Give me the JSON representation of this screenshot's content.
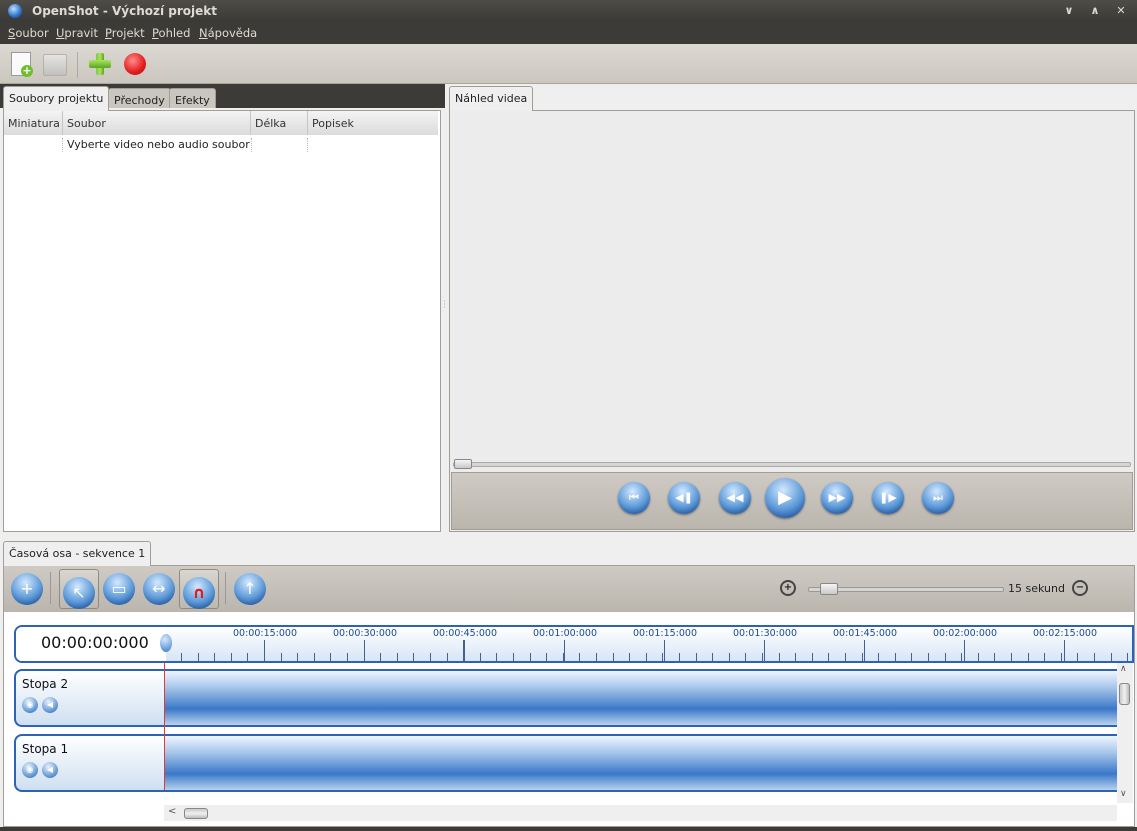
{
  "window": {
    "title": "OpenShot - Výchozí projekt"
  },
  "menu": [
    "Soubor",
    "Upravit",
    "Projekt",
    "Pohled",
    "Nápověda"
  ],
  "left_tabs": [
    "Soubory projektu",
    "Přechody",
    "Efekty"
  ],
  "file_table": {
    "columns": [
      "Miniatura",
      "Soubor",
      "Délka",
      "Popisek"
    ],
    "rows": [
      {
        "miniatura": "",
        "soubor": "Vyberte video nebo audio soubor",
        "delka": "",
        "popisek": ""
      }
    ]
  },
  "preview_tab": "Náhled videa",
  "timeline_tab": "Časová osa - sekvence 1",
  "timeline": {
    "zoom_label": "15 sekund",
    "timecode": "00:00:00:000",
    "ruler": [
      "00:00:15:000",
      "00:00:30:000",
      "00:00:45:000",
      "00:01:00:000",
      "00:01:15:000",
      "00:01:30:000",
      "00:01:45:000",
      "00:02:00:000",
      "00:02:15:000"
    ],
    "tracks": [
      {
        "name": "Stopa 2"
      },
      {
        "name": "Stopa 1"
      }
    ]
  },
  "icons": {
    "toolbar": [
      "new-project-icon",
      "save-project-icon",
      "import-files-icon",
      "record-icon"
    ],
    "transport": [
      "jump-start-icon",
      "prev-marker-icon",
      "rewind-icon",
      "play-icon",
      "fast-forward-icon",
      "next-marker-icon",
      "jump-end-icon"
    ],
    "timeline": [
      "add-track-icon",
      "select-tool-icon",
      "razor-tool-icon",
      "resize-tool-icon",
      "snapping-icon",
      "add-marker-icon",
      "zoom-in-icon",
      "zoom-out-icon"
    ]
  },
  "colors": {
    "accent": "#2d62b8",
    "playhead": "#e03a3a",
    "record": "#e21d1d",
    "chrome": "#3c3b37"
  }
}
